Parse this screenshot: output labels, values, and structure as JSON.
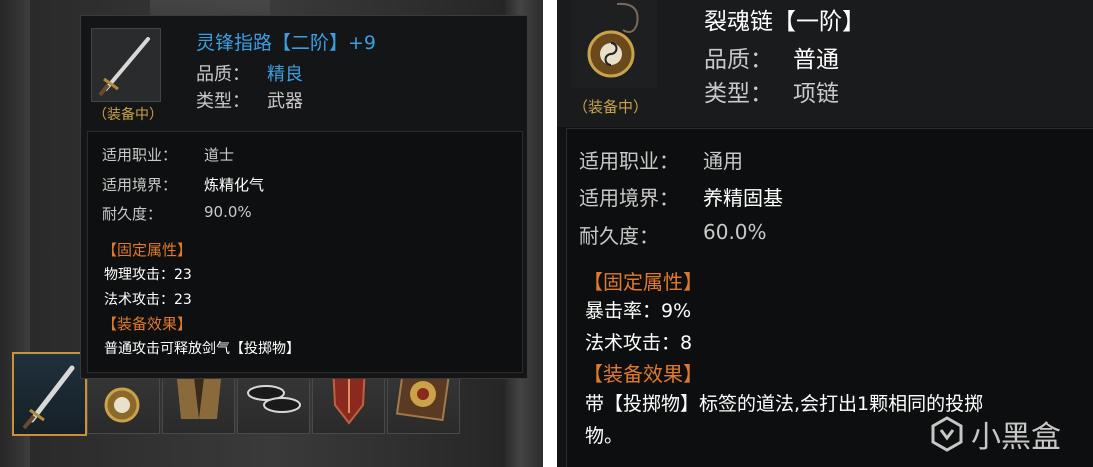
{
  "left": {
    "item_name": "灵锋指路【二阶】+9",
    "equipped_tag": "（装备中）",
    "quality_label": "品质：",
    "quality_value": "精良",
    "type_label": "类型：",
    "type_value": "武器",
    "class_label": "适用职业：",
    "class_value": "道士",
    "realm_label": "适用境界：",
    "realm_value": "炼精化气",
    "durability_label": "耐久度：",
    "durability_value": "90.0%",
    "fixed_attr_title": "【固定属性】",
    "attr1": "物理攻击：23",
    "attr2": "法术攻击：23",
    "effect_title": "【装备效果】",
    "effect_text": "普通攻击可释放剑气【投掷物】"
  },
  "right": {
    "item_name": "裂魂链【一阶】",
    "equipped_tag": "（装备中）",
    "quality_label": "品质：",
    "quality_value": "普通",
    "type_label": "类型：",
    "type_value": "项链",
    "class_label": "适用职业：",
    "class_value": "通用",
    "realm_label": "适用境界：",
    "realm_value": "养精固基",
    "durability_label": "耐久度：",
    "durability_value": "60.0%",
    "fixed_attr_title": "【固定属性】",
    "attr1": "暴击率：9%",
    "attr2": "法术攻击：8",
    "effect_title": "【装备效果】",
    "effect_line1": "带【投掷物】标签的道法,会打出1颗相同的投掷",
    "effect_line2": "物。"
  },
  "slots": [
    {
      "icon": "sword-icon"
    },
    {
      "icon": "necklace-icon"
    },
    {
      "icon": "robe-icon"
    },
    {
      "icon": "boots-icon"
    },
    {
      "icon": "shield-icon"
    },
    {
      "icon": "bagua-icon"
    }
  ],
  "watermark": "小黑盒",
  "colors": {
    "rare_blue": "#3a9fe0",
    "section_orange": "#e07a2a",
    "equipped_gold": "#c9a24a"
  }
}
